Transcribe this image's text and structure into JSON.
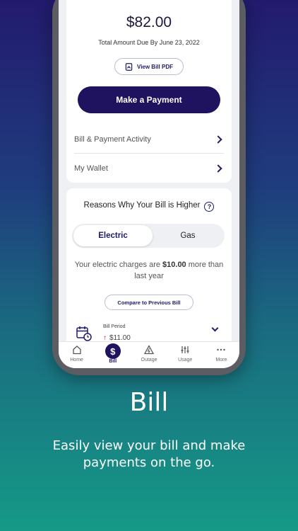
{
  "bill": {
    "amount": "$82.00",
    "due_text": "Total Amount Due By June 23, 2022",
    "view_pdf_label": "View Bill PDF",
    "pay_label": "Make a Payment"
  },
  "rows": [
    {
      "label": "Bill & Payment Activity"
    },
    {
      "label": "My Wallet"
    }
  ],
  "reasons": {
    "title": "Reasons Why Your Bill is Higher",
    "help_glyph": "?",
    "tabs": [
      "Electric",
      "Gas"
    ],
    "text_before": "Your electric charges are ",
    "text_amount": "$10.00",
    "text_after": " more than last year",
    "compare_label": "Compare to Previous Bill",
    "period_label": "Bill Period",
    "period_value": "$11.00"
  },
  "tabbar": [
    {
      "label": "Home",
      "icon": "home-icon"
    },
    {
      "label": "Bill",
      "icon": "dollar-icon"
    },
    {
      "label": "Outage",
      "icon": "outage-icon"
    },
    {
      "label": "Usage",
      "icon": "usage-icon"
    },
    {
      "label": "More",
      "icon": "more-icon"
    }
  ],
  "promo": {
    "heading": "Bill",
    "subtitle": "Easily view your bill and make payments on the go."
  },
  "colors": {
    "primary": "#1f125f",
    "accent_up": "#c8102e"
  }
}
